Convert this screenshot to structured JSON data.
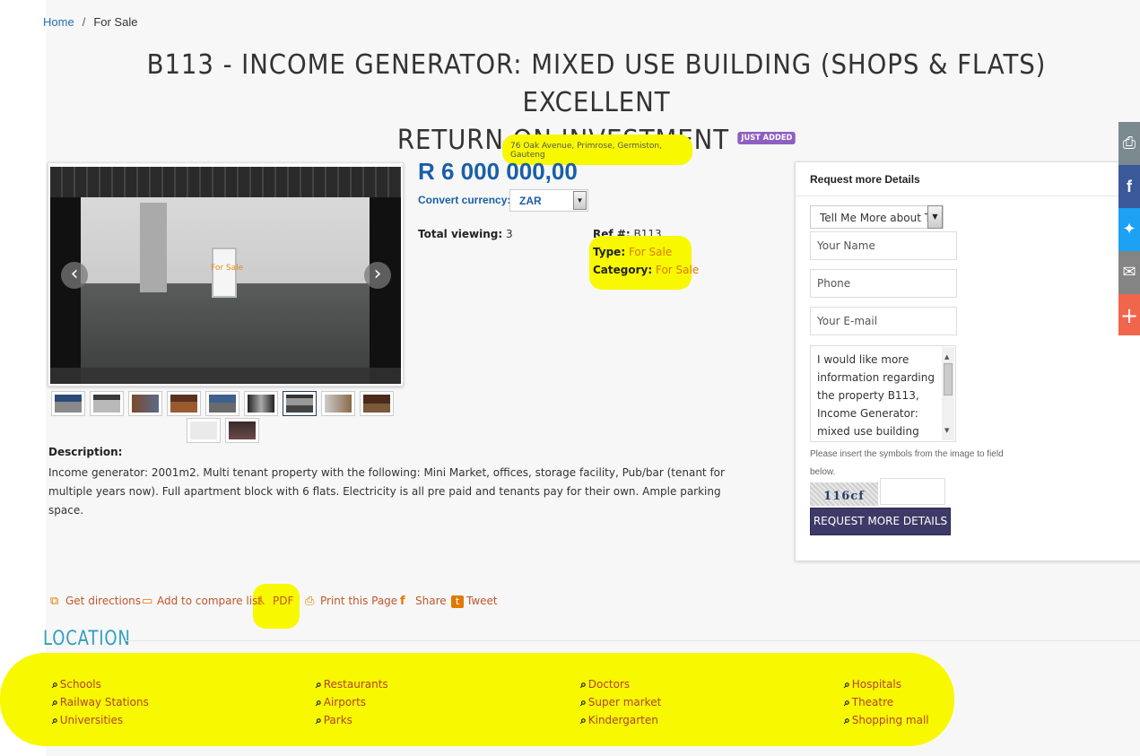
{
  "breadcrumb": {
    "home": "Home",
    "current": "For Sale"
  },
  "title": {
    "line1": "B113 - INCOME GENERATOR: MIXED USE BUILDING (SHOPS & FLATS) EXCELLENT",
    "line2": "RETURN ON INVESTMENT",
    "badge": "JUST ADDED"
  },
  "address": "76 Oak Avenue, Primrose, Germiston, Gauteng",
  "gallery": {
    "watermark": "For Sale",
    "prev": "‹",
    "next": "›"
  },
  "price": "R 6 000 000,00",
  "currency": {
    "label": "Convert currency:",
    "selected": "ZAR"
  },
  "details": {
    "total_viewing_label": "Total viewing:",
    "total_viewing": "3",
    "ref_label": "Ref #:",
    "ref": "B113",
    "type_label": "Type:",
    "type": "For Sale",
    "category_label": "Category:",
    "category": "For Sale"
  },
  "description": {
    "label": "Description:",
    "text": "Income generator: 2001m2. Multi tenant property with the following: Mini Market, offices, storage facility, Pub/bar (tenant for multiple years now). Full apartment block with 6 flats. Electricity is all pre paid and tenants pay for their own. Ample parking space."
  },
  "request": {
    "title": "Request more Details",
    "subject": "Tell Me More about Thi",
    "name_placeholder": "Your Name",
    "phone_placeholder": "Phone",
    "email_placeholder": "Your E-mail",
    "message": "I would like more information regarding the property B113, Income Generator: mixed use building",
    "captcha_note": "Please insert the symbols from the image to field below.",
    "captcha": "116cf",
    "button": "REQUEST MORE DETAILS"
  },
  "actions": {
    "directions": "Get directions",
    "compare": "Add to compare list",
    "pdf": "PDF",
    "print": "Print this Page",
    "share": "Share",
    "tweet": "Tweet"
  },
  "location": {
    "title": "LOCATION",
    "columns": [
      [
        "Schools",
        "Railway Stations",
        "Universities"
      ],
      [
        "Restaurants",
        "Airports",
        "Parks"
      ],
      [
        "Doctors",
        "Super market",
        "Kindergarten"
      ],
      [
        "Hospitals",
        "Theatre",
        "Shopping mall"
      ]
    ]
  },
  "share_bar": [
    {
      "icon": "print-icon",
      "glyph": "⎙",
      "color": "#7b8a8f"
    },
    {
      "icon": "facebook-icon",
      "glyph": "f",
      "color": "#3b5998"
    },
    {
      "icon": "twitter-icon",
      "glyph": "✦",
      "color": "#1da1f2"
    },
    {
      "icon": "email-icon",
      "glyph": "✉",
      "color": "#848484"
    },
    {
      "icon": "plus-icon",
      "glyph": "+",
      "color": "#f0664d"
    }
  ],
  "colors": {
    "link": "#2a6db5",
    "price": "#1a5fa7",
    "accent": "#e07a00",
    "poi": "#b2442b",
    "location_title": "#2ea0c2",
    "button": "#3e3a67",
    "highlight": "#f8f800"
  }
}
